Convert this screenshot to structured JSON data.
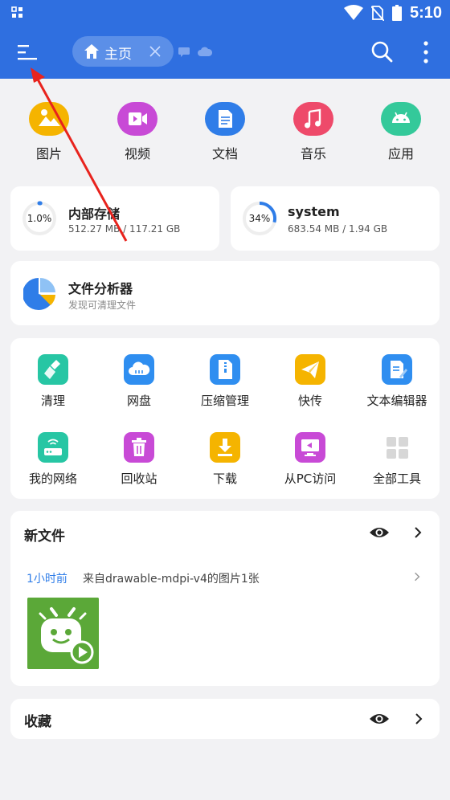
{
  "status_bar": {
    "time": "5:10"
  },
  "app_bar": {
    "tab_label": "主页"
  },
  "categories": [
    {
      "label": "图片",
      "color": "#f5b400",
      "icon": "image-icon"
    },
    {
      "label": "视频",
      "color": "#c84ad6",
      "icon": "video-icon"
    },
    {
      "label": "文档",
      "color": "#2f7de8",
      "icon": "document-icon"
    },
    {
      "label": "音乐",
      "color": "#ee4a6a",
      "icon": "music-icon"
    },
    {
      "label": "应用",
      "color": "#34c99a",
      "icon": "android-icon"
    }
  ],
  "storage": [
    {
      "percent_label": "1.0%",
      "percent": 1.0,
      "name": "内部存储",
      "usage": "512.27 MB / 117.21 GB"
    },
    {
      "percent_label": "34%",
      "percent": 34,
      "name": "system",
      "usage": "683.54 MB / 1.94 GB"
    }
  ],
  "analyzer": {
    "title": "文件分析器",
    "subtitle": "发现可清理文件"
  },
  "tools": [
    {
      "label": "清理",
      "color": "#27c6a4",
      "icon": "broom-icon"
    },
    {
      "label": "网盘",
      "color": "#2f8ef0",
      "icon": "cloud-icon"
    },
    {
      "label": "压缩管理",
      "color": "#2f8ef0",
      "icon": "zip-icon"
    },
    {
      "label": "快传",
      "color": "#f5b400",
      "icon": "send-icon"
    },
    {
      "label": "文本编辑器",
      "color": "#2f8ef0",
      "icon": "edit-document-icon"
    },
    {
      "label": "我的网络",
      "color": "#27c6a4",
      "icon": "router-icon"
    },
    {
      "label": "回收站",
      "color": "#c84ad6",
      "icon": "trash-icon"
    },
    {
      "label": "下载",
      "color": "#f5b400",
      "icon": "download-icon"
    },
    {
      "label": "从PC访问",
      "color": "#c84ad6",
      "icon": "pc-access-icon"
    },
    {
      "label": "全部工具",
      "color": "#d7d7d7",
      "icon": "grid-icon"
    }
  ],
  "new_files": {
    "title": "新文件",
    "time": "1小时前",
    "description": "来自drawable-mdpi-v4的图片1张"
  },
  "favorites": {
    "title": "收藏"
  }
}
